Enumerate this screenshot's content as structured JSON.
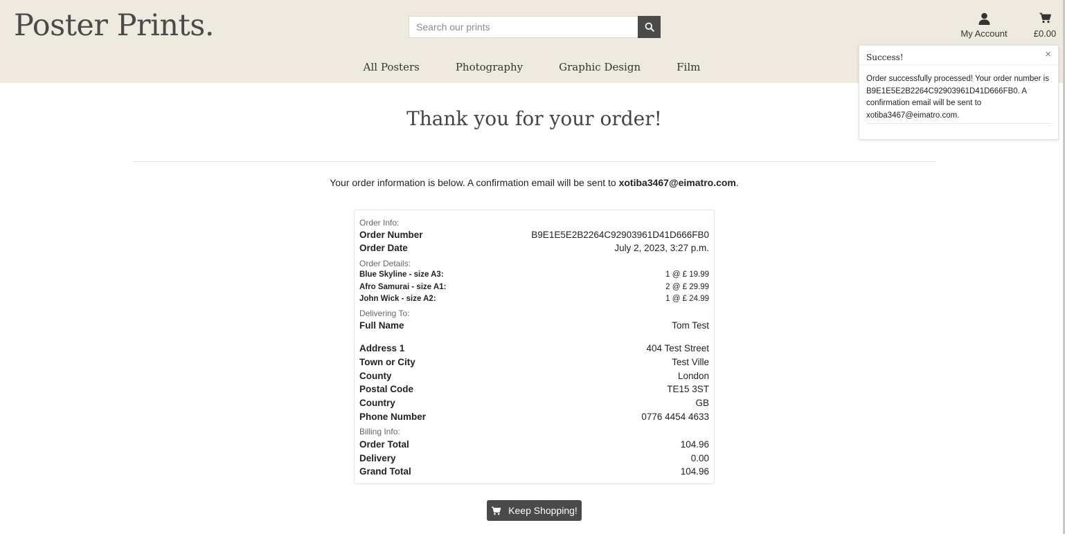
{
  "header": {
    "logo": "Poster Prints.",
    "search_placeholder": "Search our prints",
    "account_label": "My Account",
    "cart_total": "£0.00"
  },
  "nav": [
    "All Posters",
    "Photography",
    "Graphic Design",
    "Film"
  ],
  "toast": {
    "title": "Success!",
    "close": "×",
    "message": "Order successfully processed! Your order number is B9E1E5E2B2264C92903961D41D666FB0. A confirmation email will be sent to xotiba3467@eimatro.com."
  },
  "page": {
    "heading": "Thank you for your order!",
    "intro_prefix": "Your order information is below. A confirmation email will be sent to ",
    "intro_email": "xotiba3467@eimatro.com",
    "intro_suffix": "."
  },
  "order": {
    "order_info_label": "Order Info:",
    "order_number_label": "Order Number",
    "order_number": "B9E1E5E2B2264C92903961D41D666FB0",
    "order_date_label": "Order Date",
    "order_date": "July 2, 2023, 3:27 p.m.",
    "order_details_label": "Order Details:",
    "items": [
      {
        "name": "Blue Skyline - size A3:",
        "qty_price": "1 @ £ 19.99"
      },
      {
        "name": "Afro Samurai - size A1:",
        "qty_price": "2 @ £ 29.99"
      },
      {
        "name": "John Wick - size A2:",
        "qty_price": "1 @ £ 24.99"
      }
    ],
    "delivering_label": "Delivering To:",
    "delivery": [
      {
        "label": "Full Name",
        "value": "Tom Test"
      },
      {
        "label": "Address 1",
        "value": "404 Test Street"
      },
      {
        "label": "Town or City",
        "value": "Test Ville"
      },
      {
        "label": "County",
        "value": "London"
      },
      {
        "label": "Postal Code",
        "value": "TE15 3ST"
      },
      {
        "label": "Country",
        "value": "GB"
      },
      {
        "label": "Phone Number",
        "value": "0776 4454 4633"
      }
    ],
    "billing_label": "Billing Info:",
    "billing": [
      {
        "label": "Order Total",
        "value": "104.96"
      },
      {
        "label": "Delivery",
        "value": "0.00"
      },
      {
        "label": "Grand Total",
        "value": "104.96"
      }
    ]
  },
  "keep_shopping": "Keep Shopping!"
}
